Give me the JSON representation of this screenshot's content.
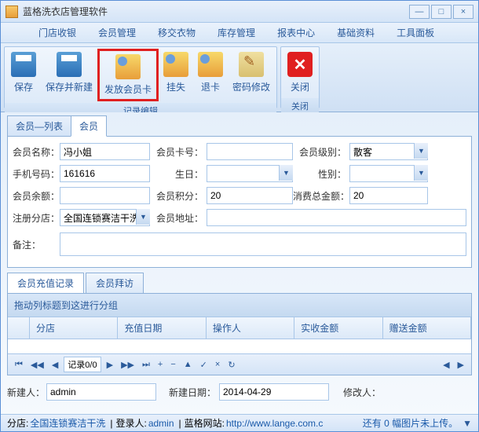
{
  "title": "蓝格洗衣店管理软件",
  "winbtns": {
    "min": "—",
    "max": "□",
    "close": "×"
  },
  "menu": [
    "门店收银",
    "会员管理",
    "移交衣物",
    "库存管理",
    "报表中心",
    "基础资料",
    "工具面板"
  ],
  "ribbon": {
    "group1": {
      "label": "记录编辑",
      "items": [
        "保存",
        "保存并新建",
        "发放会员卡",
        "挂失",
        "退卡",
        "密码修改"
      ]
    },
    "group2": {
      "label": "关闭",
      "items": [
        "关闭"
      ]
    }
  },
  "tabs": {
    "list": "会员—列表",
    "detail": "会员"
  },
  "form": {
    "labels": {
      "name": "会员名称：",
      "cardno": "会员卡号：",
      "level": "会员级别：",
      "phone": "手机号码：",
      "birthday": "生日：",
      "gender": "性别：",
      "balance": "会员余额：",
      "points": "会员积分：",
      "total": "消费总金额：",
      "branch": "注册分店：",
      "address": "会员地址：",
      "remark": "备注："
    },
    "values": {
      "name": "冯小姐",
      "cardno": "",
      "level": "散客",
      "phone": "161616",
      "birthday": "",
      "gender": "",
      "balance": "",
      "points": "20",
      "total": "20",
      "branch": "全国连锁赛洁干洗",
      "address": "",
      "remark": ""
    }
  },
  "subtabs": {
    "recharge": "会员充值记录",
    "visit": "会员拜访"
  },
  "grid": {
    "groupbar": "拖动列标题到这进行分组",
    "cols": [
      "",
      "分店",
      "充值日期",
      "操作人",
      "实收金额",
      "赠送金额"
    ],
    "nav": "记录0/0"
  },
  "footer": {
    "creator_label": "新建人：",
    "creator": "admin",
    "cdate_label": "新建日期：",
    "cdate": "2014-04-29",
    "modifier_label": "修改人："
  },
  "status": {
    "branch_label": "分店:",
    "branch": "全国连锁赛洁干洗",
    "login_label": "登录人:",
    "login": "admin",
    "site_label": "蓝格网站:",
    "site": "http://www.lange.com.c",
    "upload": "还有 0 幅图片未上传。"
  }
}
